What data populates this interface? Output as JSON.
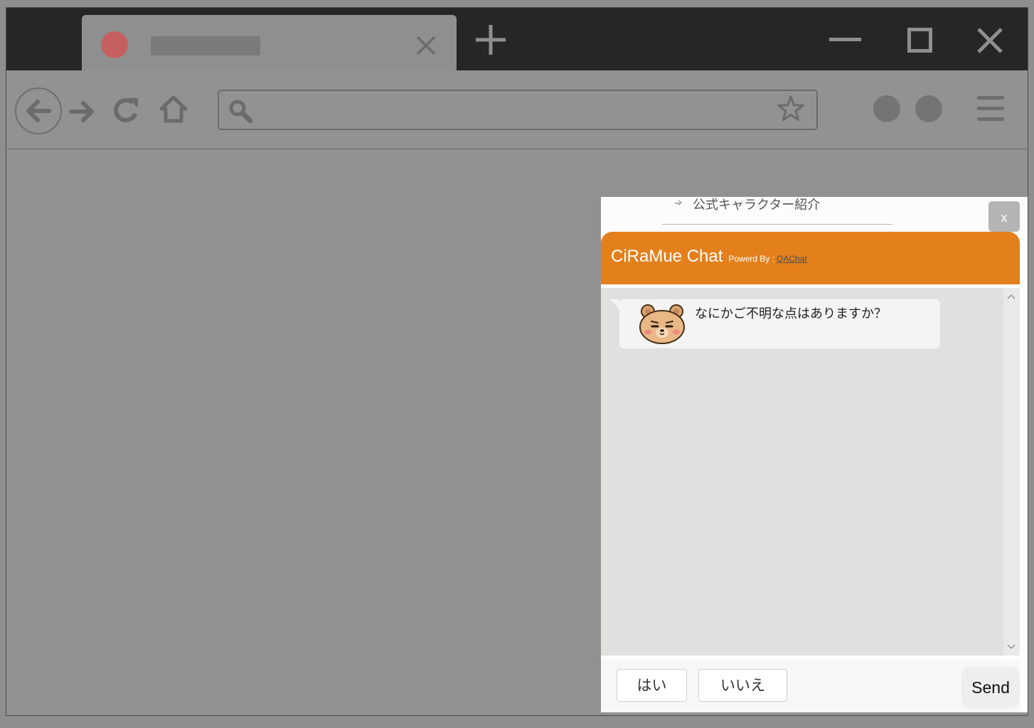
{
  "browser": {
    "tab": {
      "favicon": "tab-favicon-dot",
      "close_icon": "close-icon"
    },
    "new_tab_icon": "plus-icon",
    "window_controls": [
      "minimize-icon",
      "maximize-icon",
      "close-icon"
    ],
    "toolbar": {
      "nav_icons": [
        "back-arrow-icon",
        "forward-arrow-icon",
        "reload-icon",
        "home-icon"
      ],
      "address_bar_icons": [
        "search-icon",
        "star-icon"
      ],
      "extension_icons": [
        "extension-dot-icon",
        "extension-dot-icon"
      ],
      "menu_icon": "hamburger-menu-icon"
    }
  },
  "chat_widget": {
    "top_link": {
      "icon": "arrow-right-icon",
      "label": "公式キャラクター紹介"
    },
    "close_button_label": "x",
    "header": {
      "title": "CiRaMue Chat",
      "powered_by_prefix": "Powerd By :",
      "powered_by_link": "QAChat"
    },
    "messages": [
      {
        "sender": "bot",
        "avatar": "bear-avatar-icon",
        "text": "なにかご不明な点はありますか？"
      }
    ],
    "quick_replies": [
      {
        "label": "はい"
      },
      {
        "label": "いいえ"
      }
    ],
    "send_label": "Send",
    "scrollbar_icons": [
      "chevron-up-icon",
      "chevron-down-icon"
    ]
  },
  "colors": {
    "accent": "#e4801c",
    "overlay": "#919191",
    "titlebar": "#262626",
    "chat_background": "#e0e0df",
    "favicon": "#c65f60"
  }
}
